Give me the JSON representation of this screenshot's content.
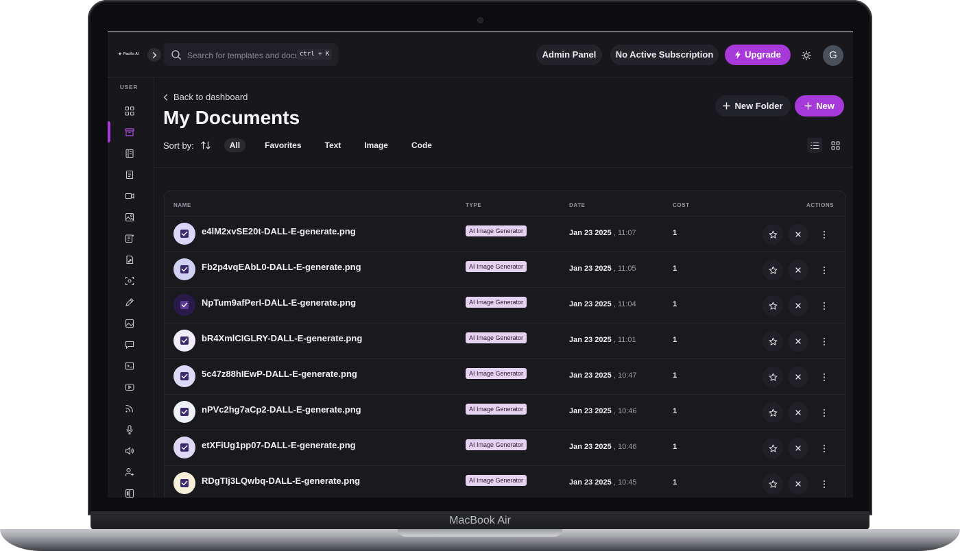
{
  "device": {
    "label": "MacBook Air"
  },
  "app": {
    "logo_text": "Pacific AI"
  },
  "search": {
    "placeholder": "Search for templates and documents...",
    "shortcut": "ctrl + K"
  },
  "header": {
    "admin_label": "Admin Panel",
    "subscription_label": "No Active Subscription",
    "upgrade_label": "Upgrade",
    "avatar_initial": "G"
  },
  "sidebar": {
    "section_label": "USER",
    "items": [
      "dashboard",
      "documents",
      "templates",
      "ai-writer",
      "ai-video",
      "ai-image",
      "ai-article",
      "ai-rewriter",
      "ai-vision",
      "ai-editor",
      "ai-image-alt",
      "ai-chat",
      "ai-code",
      "ai-youtube",
      "ai-rss",
      "ai-speech-to-text",
      "ai-voiceover",
      "affiliates",
      "ai-brand"
    ],
    "active_index": 1
  },
  "page": {
    "back_label": "Back to dashboard",
    "title": "My Documents",
    "new_folder_label": "New Folder",
    "new_label": "New",
    "sort_label": "Sort by:",
    "filters": [
      "All",
      "Favorites",
      "Text",
      "Image",
      "Code"
    ],
    "active_filter": "All"
  },
  "table": {
    "columns": {
      "name": "NAME",
      "type": "TYPE",
      "date": "DATE",
      "cost": "COST",
      "actions": "ACTIONS"
    },
    "rows": [
      {
        "name": "e4lM2xvSE20t-DALL-E-generate.png",
        "type": "AI Image Generator",
        "date": "Jan 23 2025",
        "time": ", 11:07",
        "cost": "1",
        "thumb_color": "#d9d6f7"
      },
      {
        "name": "Fb2p4vqEAbL0-DALL-E-generate.png",
        "type": "AI Image Generator",
        "date": "Jan 23 2025",
        "time": ", 11:05",
        "cost": "1",
        "thumb_color": "#cfd0f2"
      },
      {
        "name": "NpTum9afPerI-DALL-E-generate.png",
        "type": "AI Image Generator",
        "date": "Jan 23 2025",
        "time": ", 11:04",
        "cost": "1",
        "thumb_color": "#2a1a4a"
      },
      {
        "name": "bR4XmlCIGLRY-DALL-E-generate.png",
        "type": "AI Image Generator",
        "date": "Jan 23 2025",
        "time": ", 11:01",
        "cost": "1",
        "thumb_color": "#f1ecfb"
      },
      {
        "name": "5c47z88hIEwP-DALL-E-generate.png",
        "type": "AI Image Generator",
        "date": "Jan 23 2025",
        "time": ", 10:47",
        "cost": "1",
        "thumb_color": "#dcdaf7"
      },
      {
        "name": "nPVc2hg7aCp2-DALL-E-generate.png",
        "type": "AI Image Generator",
        "date": "Jan 23 2025",
        "time": ", 10:46",
        "cost": "1",
        "thumb_color": "#eef0f7"
      },
      {
        "name": "etXFiUg1pp07-DALL-E-generate.png",
        "type": "AI Image Generator",
        "date": "Jan 23 2025",
        "time": ", 10:46",
        "cost": "1",
        "thumb_color": "#ded8f5"
      },
      {
        "name": "RDgTIj3LQwbq-DALL-E-generate.png",
        "type": "AI Image Generator",
        "date": "Jan 23 2025",
        "time": ", 10:45",
        "cost": "1",
        "thumb_color": "#f6efd8"
      }
    ]
  },
  "colors": {
    "accent": "#a738d9",
    "background": "#18181c",
    "badge": "#e6d2f1"
  }
}
